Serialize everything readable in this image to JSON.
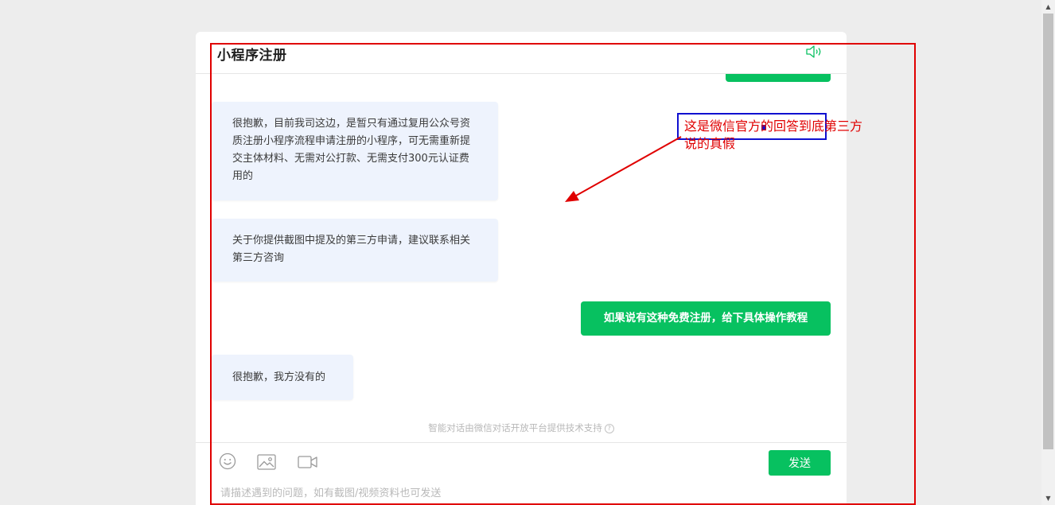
{
  "chat": {
    "title": "小程序注册",
    "messages": [
      {
        "from": "service",
        "text": "很抱歉，目前我司这边，是暂只有通过复用公众号资质注册小程序流程申请注册的小程序，可无需重新提交主体材料、无需对公打款、无需支付300元认证费用的"
      },
      {
        "from": "service",
        "text": "关于你提供截图中提及的第三方申请，建议联系相关第三方咨询"
      },
      {
        "from": "user",
        "text": "如果说有这种免费注册，给下具体操作教程"
      },
      {
        "from": "service",
        "text": "很抱歉，我方没有的"
      }
    ],
    "powered_by": "智能对话由微信对话开放平台提供技术支持",
    "help_icon": "?",
    "input_placeholder": "请描述遇到的问题，如有截图/视频资料也可发送",
    "send_label": "发送",
    "icons": [
      "speaker-icon",
      "emoji-icon",
      "image-icon",
      "video-icon"
    ],
    "accent_color": "#07c160"
  },
  "annotation": {
    "text": "这是微信官方的回答到底第三方说的真假",
    "frame_color": "#e00000",
    "box_color": "#1010d0"
  },
  "scrollbar": {
    "up": "▲",
    "down": "▼"
  }
}
